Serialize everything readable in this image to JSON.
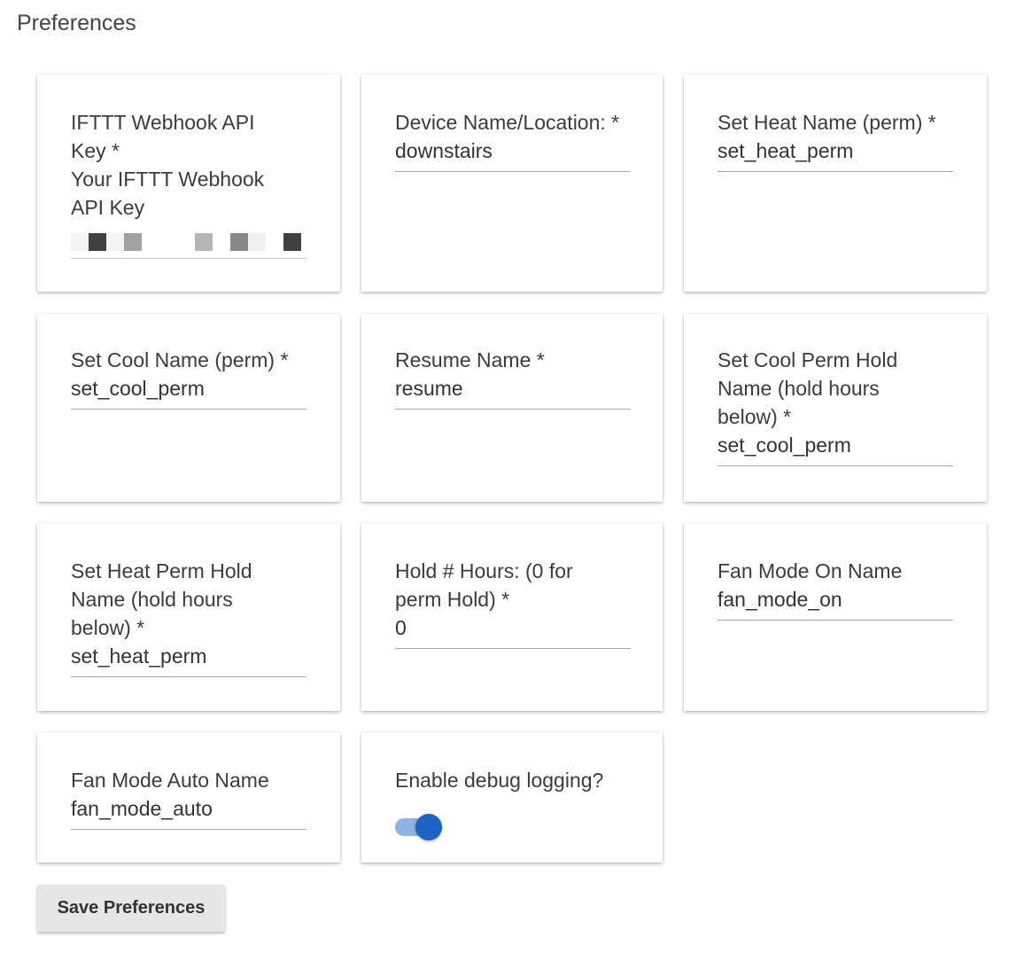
{
  "page": {
    "title": "Preferences"
  },
  "fields": {
    "ifttt_key": {
      "label": "IFTTT Webhook API Key *",
      "hint": "Your IFTTT Webhook API Key"
    },
    "device_name": {
      "label": "Device Name/Location: *",
      "value": "downstairs"
    },
    "set_heat_name": {
      "label": "Set Heat Name (perm) *",
      "value": "set_heat_perm"
    },
    "set_cool_name": {
      "label": "Set Cool Name (perm) *",
      "value": "set_cool_perm"
    },
    "resume_name": {
      "label": "Resume Name *",
      "value": "resume"
    },
    "set_cool_hold_name": {
      "label": "Set Cool Perm Hold Name (hold hours below) *",
      "value": "set_cool_perm"
    },
    "set_heat_hold_name": {
      "label": "Set Heat Perm Hold Name (hold hours below) *",
      "value": "set_heat_perm"
    },
    "hold_hours": {
      "label": "Hold # Hours: (0 for perm Hold) *",
      "value": "0"
    },
    "fan_on_name": {
      "label": "Fan Mode On Name",
      "value": "fan_mode_on"
    },
    "fan_auto_name": {
      "label": "Fan Mode Auto Name",
      "value": "fan_mode_auto"
    },
    "debug_logging": {
      "label": "Enable debug logging?",
      "enabled": true
    }
  },
  "actions": {
    "save_label": "Save Preferences"
  },
  "colors": {
    "toggle_thumb": "#1d63c4",
    "toggle_track": "#8fb3e2",
    "button_bg": "#e6e6e6"
  }
}
